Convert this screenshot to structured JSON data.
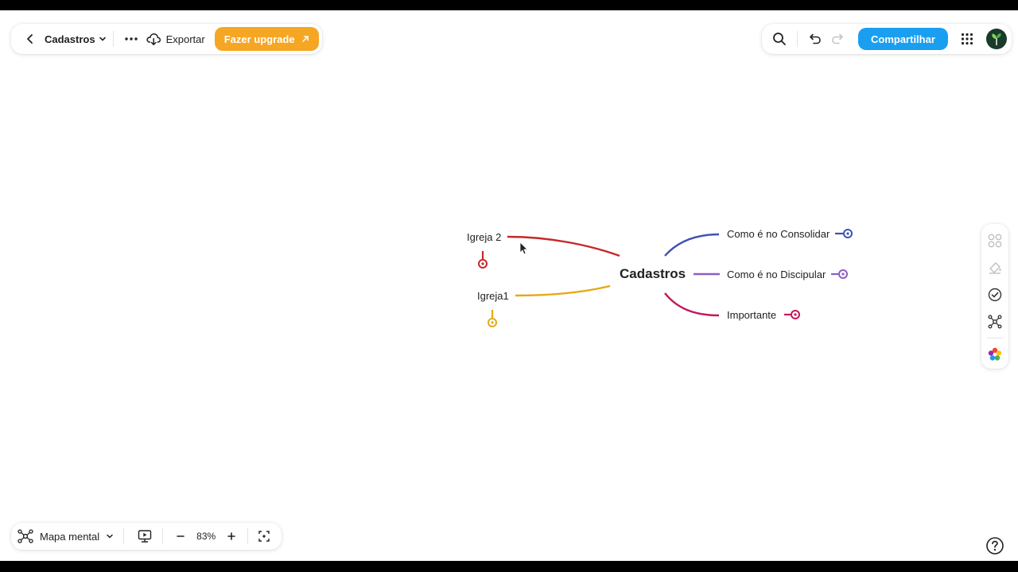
{
  "header": {
    "doc_title": "Cadastros",
    "export_label": "Exportar",
    "upgrade_label": "Fazer upgrade",
    "share_label": "Compartilhar"
  },
  "mindmap": {
    "central": "Cadastros",
    "left_topics": [
      {
        "label": "Igreja 2",
        "color": "#c62828"
      },
      {
        "label": "Igreja1",
        "color": "#e6a817"
      }
    ],
    "right_topics": [
      {
        "label": "Como é no Consolidar",
        "color": "#3f51b5"
      },
      {
        "label": "Como é no Discipular",
        "color": "#8e5cc4"
      },
      {
        "label": "Importante",
        "color": "#c2185b"
      }
    ]
  },
  "bottom_bar": {
    "mode_label": "Mapa mental",
    "zoom": "83%"
  },
  "colors": {
    "accent": "#1a9ff0",
    "upgrade": "#f5a623"
  },
  "icons": [
    "back-icon",
    "chevron-down-icon",
    "more-icon",
    "cloud-download-icon",
    "external-arrow-icon",
    "search-icon",
    "undo-icon",
    "redo-icon",
    "apps-grid-icon",
    "avatar",
    "mindmap-icon",
    "present-icon",
    "zoom-out-icon",
    "zoom-in-icon",
    "fit-screen-icon",
    "help-icon",
    "layout-icon",
    "style-brush-icon",
    "check-circle-icon",
    "structure-icon",
    "color-palette-icon"
  ]
}
